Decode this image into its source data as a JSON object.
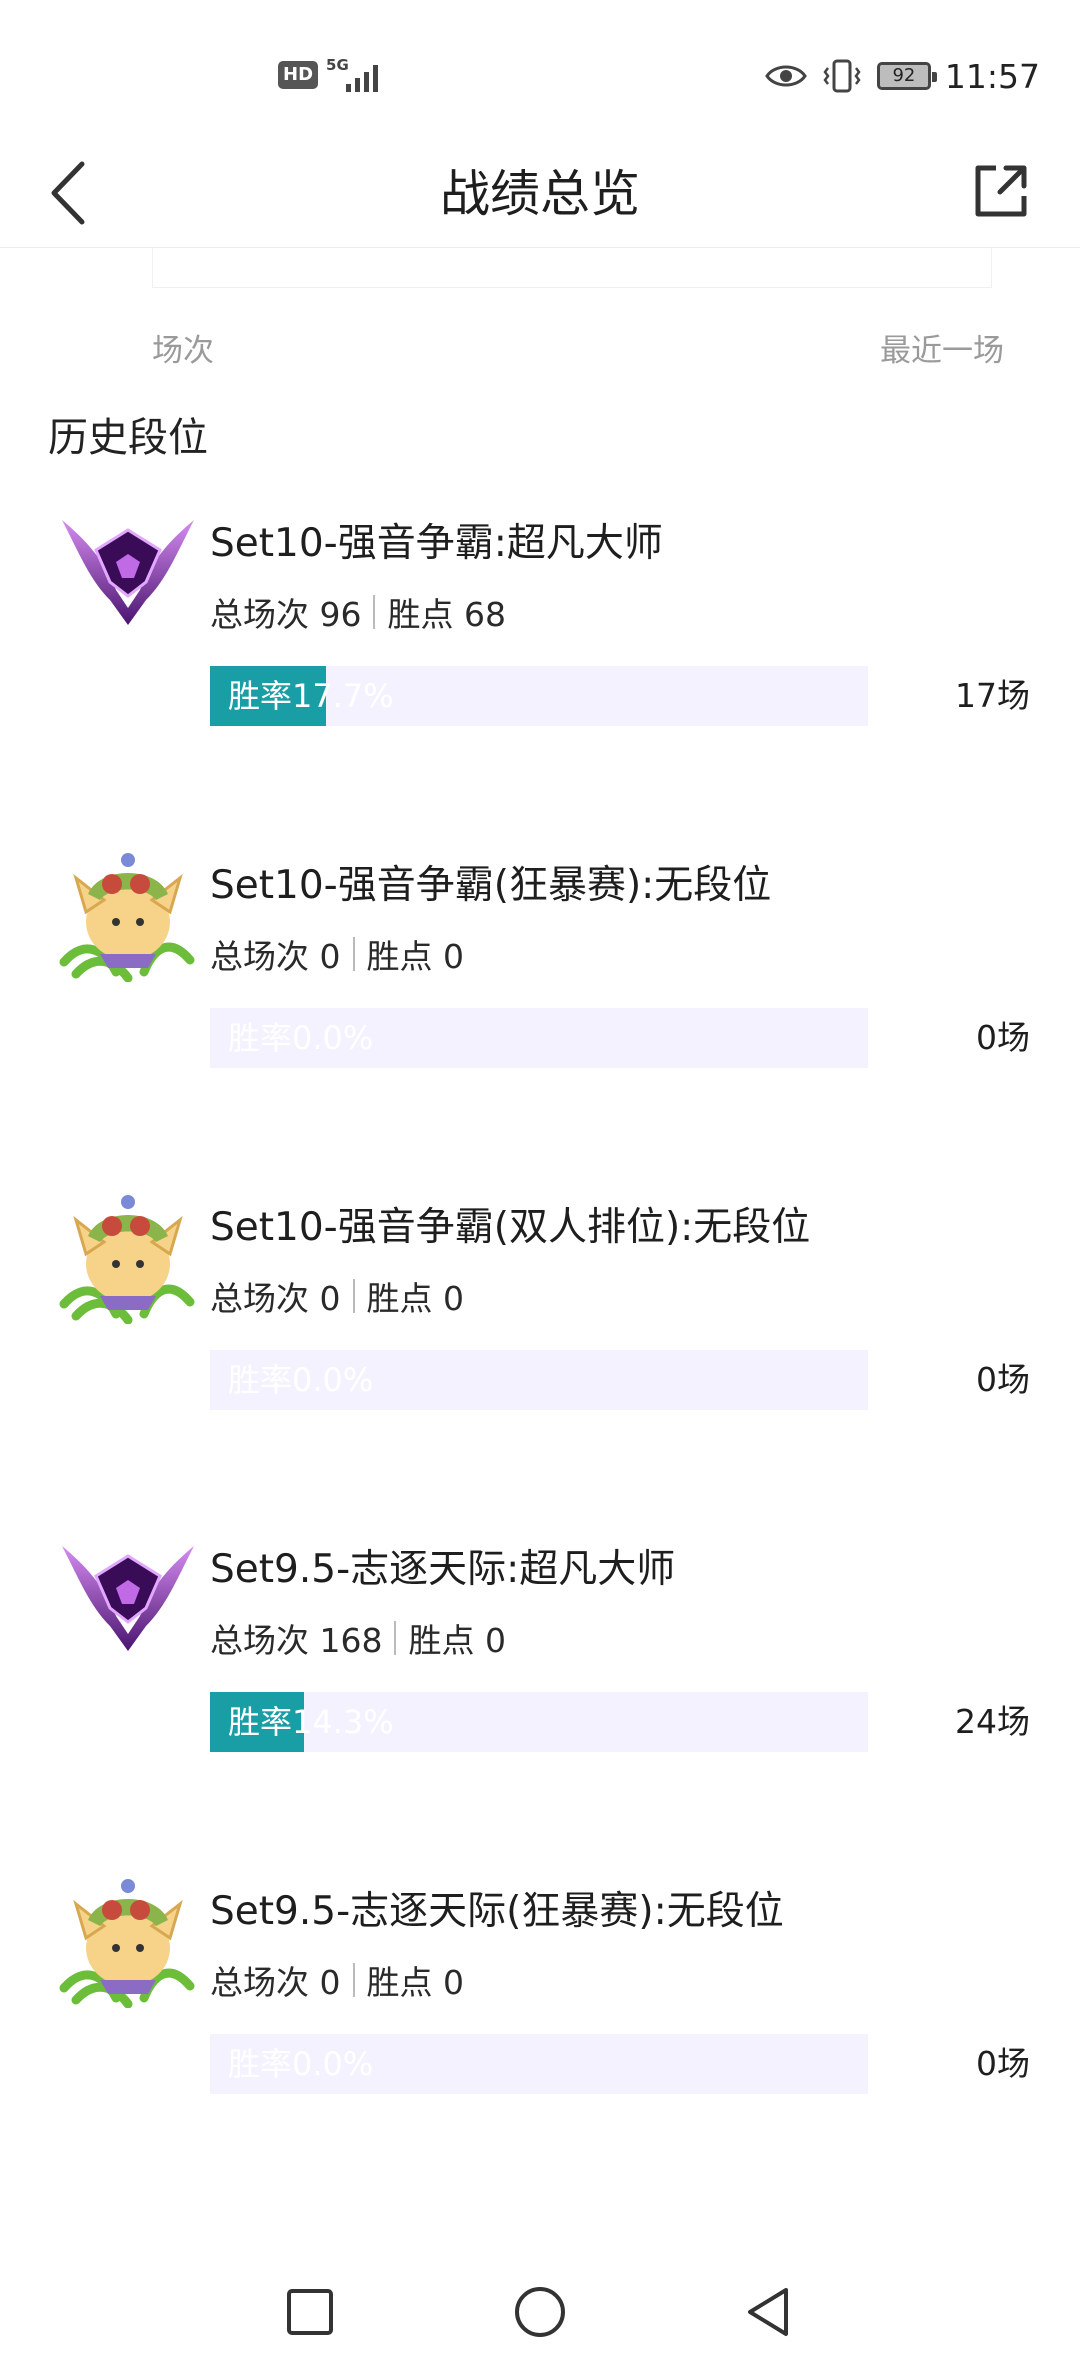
{
  "status_bar": {
    "hd": "HD",
    "network": "5G",
    "battery": "92",
    "time": "11:57"
  },
  "header": {
    "title": "战绩总览"
  },
  "stats": {
    "left_label": "场次",
    "right_label": "最近一场"
  },
  "section_title": "历史段位",
  "ranks": [
    {
      "icon": "master-emblem-icon",
      "name": "Set10-强音争霸:超凡大师",
      "games_label": "总场次 96",
      "points_label": "胜点 68",
      "winrate_text": "胜率17.7%",
      "winrate": 0.177,
      "count": "17场"
    },
    {
      "icon": "teemo-unranked-icon",
      "name": "Set10-强音争霸(狂暴赛):无段位",
      "games_label": "总场次 0",
      "points_label": "胜点 0",
      "winrate_text": "胜率0.0%",
      "winrate": 0.0,
      "count": "0场"
    },
    {
      "icon": "teemo-unranked-icon",
      "name": "Set10-强音争霸(双人排位):无段位",
      "games_label": "总场次 0",
      "points_label": "胜点 0",
      "winrate_text": "胜率0.0%",
      "winrate": 0.0,
      "count": "0场"
    },
    {
      "icon": "master-emblem-icon",
      "name": "Set9.5-志逐天际:超凡大师",
      "games_label": "总场次 168",
      "points_label": "胜点 0",
      "winrate_text": "胜率14.3%",
      "winrate": 0.143,
      "count": "24场"
    },
    {
      "icon": "teemo-unranked-icon",
      "name": "Set9.5-志逐天际(狂暴赛):无段位",
      "games_label": "总场次 0",
      "points_label": "胜点 0",
      "winrate_text": "胜率0.0%",
      "winrate": 0.0,
      "count": "0场"
    }
  ],
  "colors": {
    "accent": "#1a9ea5",
    "bar_track": "#f4f2fe",
    "secondary_text": "#9a9a9a"
  },
  "nav": {
    "recent_icon": "square-icon",
    "home_icon": "circle-icon",
    "back_icon": "triangle-back-icon"
  }
}
